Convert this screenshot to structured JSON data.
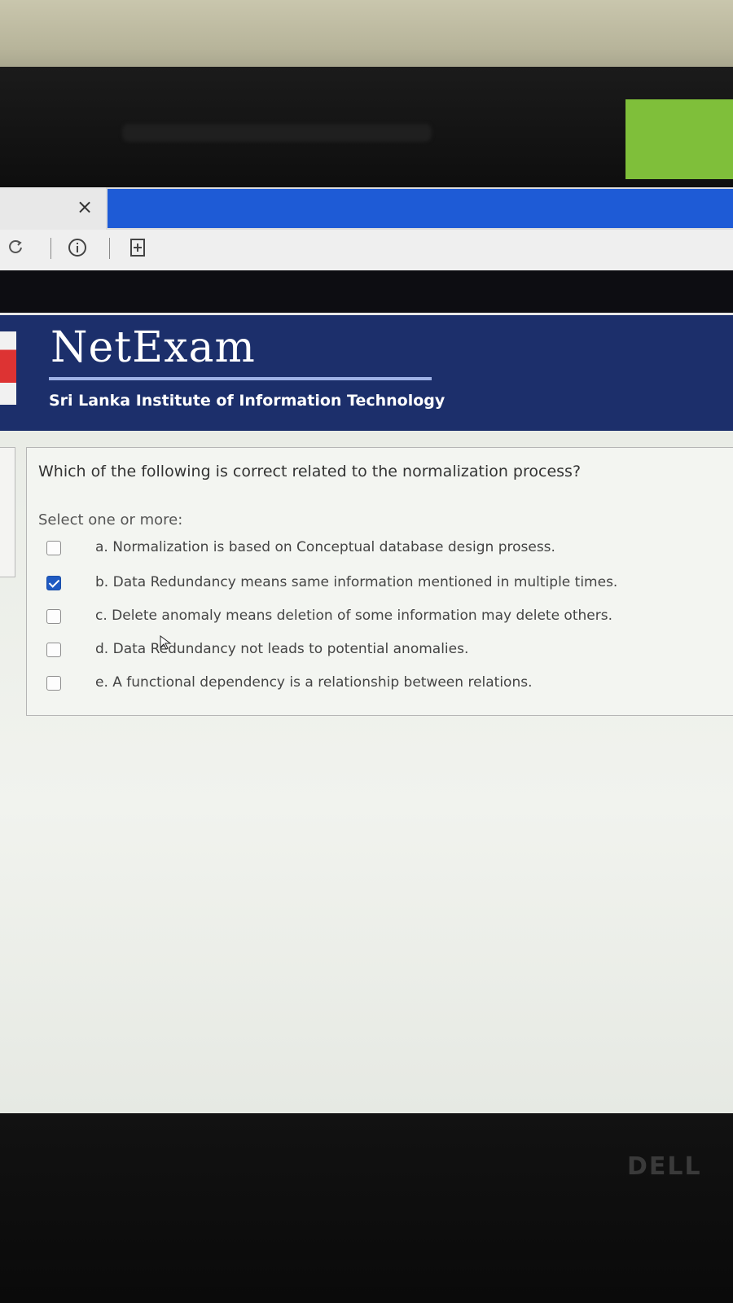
{
  "browser": {
    "tab_close_glyph": "×",
    "refresh_icon": "refresh-icon",
    "info_icon": "info-icon",
    "page_icon": "page-add-icon"
  },
  "banner": {
    "title": "NetExam",
    "subtitle": "Sri Lanka Institute of Information Technology"
  },
  "question": {
    "text": "Which of the following is correct related to the normalization process?",
    "prompt": "Select one or more:",
    "options": [
      {
        "label": "a. Normalization  is based on Conceptual database design prosess.",
        "checked": false
      },
      {
        "label": "b. Data Redundancy means same information mentioned in multiple times.",
        "checked": true
      },
      {
        "label": "c. Delete anomaly means deletion of some information may delete others.",
        "checked": false
      },
      {
        "label": "d. Data Redundancy not leads to potential anomalies.",
        "checked": false
      },
      {
        "label": "e. A functional dependency is a relationship between relations.",
        "checked": false
      }
    ]
  },
  "monitor": {
    "brand": "DELL"
  },
  "colors": {
    "banner_bg": "#1c2f6b",
    "banner_accent": "#d24c2b",
    "tab_blue": "#1e5bd6",
    "checkbox_checked": "#1f5ac2"
  }
}
